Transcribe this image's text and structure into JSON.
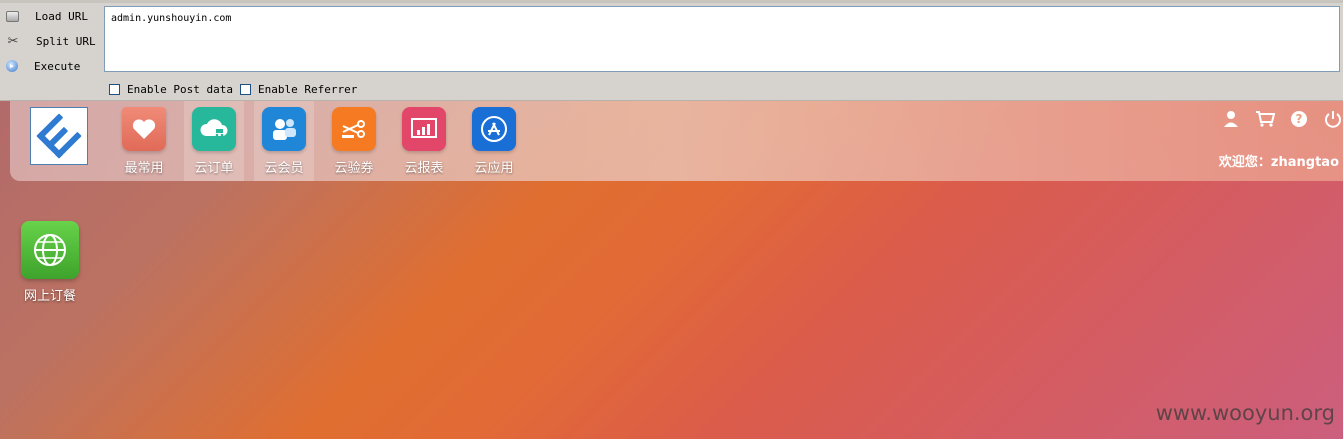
{
  "hackbar": {
    "commands": [
      {
        "label": "Load URL",
        "icon": "load-url-icon"
      },
      {
        "label": "Split URL",
        "icon": "split-url-icon"
      },
      {
        "label": "Execute",
        "icon": "execute-icon"
      }
    ],
    "url_value": "admin.yunshouyin.com",
    "options": [
      {
        "label": "Enable Post data",
        "checked": false
      },
      {
        "label": "Enable Referrer",
        "checked": false
      }
    ]
  },
  "taskbar": {
    "apps": [
      {
        "label": "最常用",
        "icon": "heart-folder-icon",
        "color": "#e8735e"
      },
      {
        "label": "云订单",
        "icon": "cloud-cart-icon",
        "color": "#27b89b"
      },
      {
        "label": "云会员",
        "icon": "members-icon",
        "color": "#1f86d8"
      },
      {
        "label": "云验券",
        "icon": "scissors-coupon-icon",
        "color": "#f57a22"
      },
      {
        "label": "云报表",
        "icon": "report-chart-icon",
        "color": "#e24668"
      },
      {
        "label": "云应用",
        "icon": "app-store-icon",
        "color": "#1a6fd6"
      }
    ],
    "welcome_text": "欢迎您：zhangtao",
    "right_icons": [
      "user-icon",
      "cart-icon",
      "help-icon",
      "power-icon"
    ]
  },
  "desktop": {
    "icons": [
      {
        "label": "网上订餐",
        "icon": "globe-icon",
        "color": "#4cbd35"
      }
    ]
  },
  "watermark": "www.wooyun.org"
}
